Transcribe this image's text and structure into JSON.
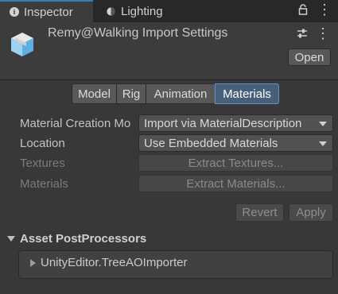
{
  "tabs": [
    {
      "label": "Inspector",
      "icon": "info-icon"
    },
    {
      "label": "Lighting",
      "icon": "lighting-icon"
    }
  ],
  "header": {
    "title": "Remy@Walking Import Settings",
    "open_label": "Open"
  },
  "segments": [
    {
      "label": "Model"
    },
    {
      "label": "Rig"
    },
    {
      "label": "Animation"
    },
    {
      "label": "Materials",
      "selected": true
    }
  ],
  "fields": {
    "material_creation_mode": {
      "label": "Material Creation Mo",
      "value": "Import via MaterialDescription"
    },
    "location": {
      "label": "Location",
      "value": "Use Embedded Materials"
    },
    "textures": {
      "label": "Textures",
      "button": "Extract Textures..."
    },
    "materials": {
      "label": "Materials",
      "button": "Extract Materials..."
    }
  },
  "actions": {
    "revert": "Revert",
    "apply": "Apply"
  },
  "postprocessors": {
    "title": "Asset PostProcessors",
    "items": [
      "UnityEditor.TreeAOImporter"
    ]
  },
  "colors": {
    "accent": "#3a79bb",
    "selected_segment": "#46607c"
  }
}
